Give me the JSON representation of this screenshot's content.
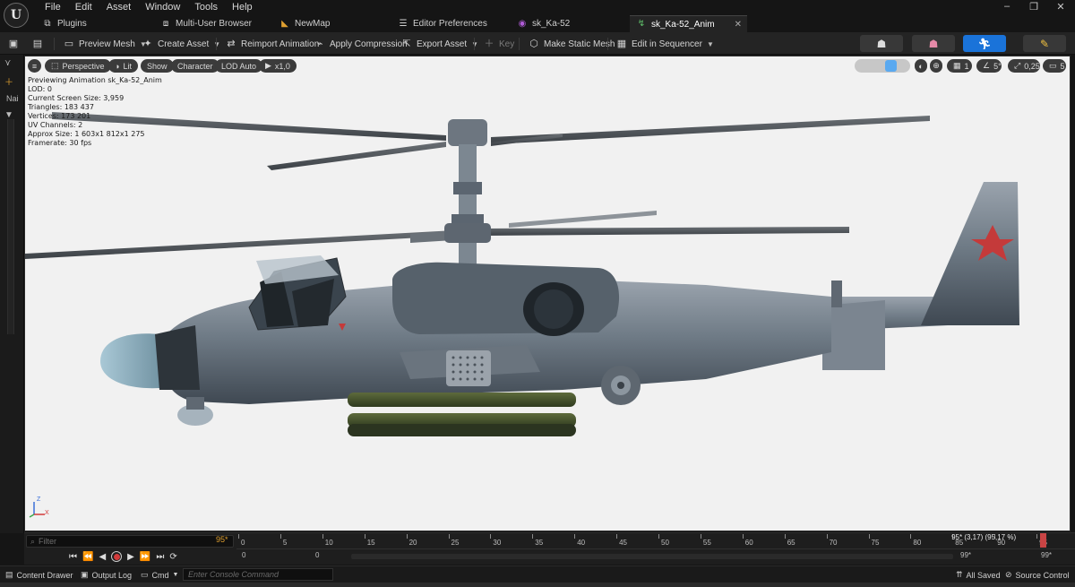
{
  "app": {
    "logo": "U"
  },
  "menu": [
    "File",
    "Edit",
    "Asset",
    "Window",
    "Tools",
    "Help"
  ],
  "window_controls": {
    "minimize": "–",
    "maximize": "❐",
    "close": "✕"
  },
  "tabs": [
    {
      "label": "Plugins",
      "icon": "plugin-icon"
    },
    {
      "label": "Multi-User Browser",
      "icon": "multi-user-icon"
    },
    {
      "label": "NewMap",
      "icon": "map-icon"
    },
    {
      "label": "Editor Preferences",
      "icon": "preferences-icon"
    },
    {
      "label": "sk_Ka-52",
      "icon": "skeleton-icon"
    },
    {
      "label": "sk_Ka-52_Anim",
      "icon": "animation-icon",
      "active": true
    }
  ],
  "toolbar": {
    "preview_mesh": "Preview Mesh",
    "create_asset": "Create Asset",
    "reimport_animation": "Reimport Animation",
    "apply_compression": "Apply Compression",
    "export_asset": "Export Asset",
    "key": "Key",
    "make_static_mesh": "Make Static Mesh",
    "edit_in_sequencer": "Edit in Sequencer"
  },
  "left_strip": {
    "label": "Nai"
  },
  "viewport": {
    "perspective": "Perspective",
    "lit": "Lit",
    "show": "Show",
    "character": "Character",
    "lod": "LOD Auto",
    "play_rate": "x1,0",
    "right_values": {
      "grid": "1",
      "angle": "5°",
      "scale": "0,25",
      "camera_speed": "5"
    },
    "stats": [
      "Previewing Animation sk_Ka-52_Anim",
      "LOD: 0",
      "Current Screen Size: 3,959",
      "Triangles: 183 437",
      "Vertices: 173 201",
      "UV Channels: 2",
      "Approx Size: 1 603x1 812x1 275",
      "Framerate: 30 fps"
    ],
    "axis": {
      "z": "Z",
      "x": "X"
    }
  },
  "timeline": {
    "filter_placeholder": "Filter",
    "current_frame": "95*",
    "playhead_label": "95* (3,17) (95,17 %)",
    "ticks": [
      "0",
      "5",
      "10",
      "15",
      "20",
      "25",
      "30",
      "35",
      "40",
      "45",
      "50",
      "55",
      "60",
      "65",
      "70",
      "75",
      "80",
      "85",
      "90",
      "95"
    ],
    "range_start_a": "0",
    "range_start_b": "0",
    "range_end_a": "99*",
    "range_end_b": "99*"
  },
  "status": {
    "content_drawer": "Content Drawer",
    "output_log": "Output Log",
    "cmd": "Cmd",
    "console_placeholder": "Enter Console Command",
    "all_saved": "All Saved",
    "source_control": "Source Control"
  },
  "colors": {
    "accent": "#1a73d9",
    "viewport_bg": "#f1f1f1",
    "record": "#d23a3a",
    "frame_badge": "#e0a030"
  }
}
